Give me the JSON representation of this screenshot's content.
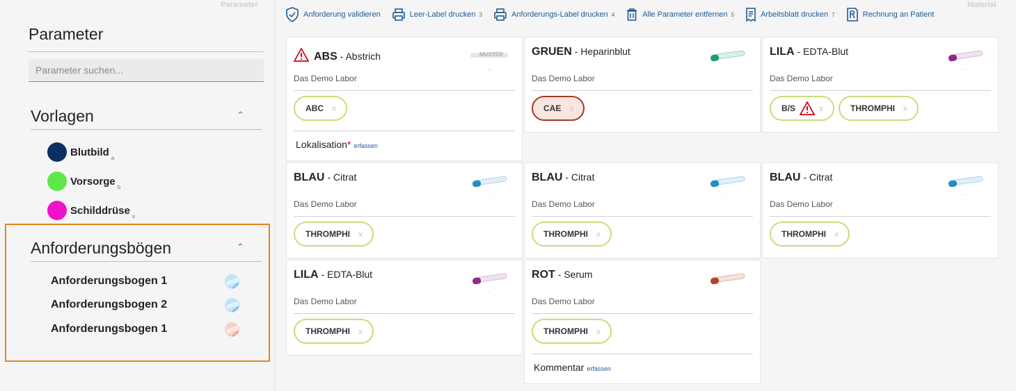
{
  "sidebar": {
    "corner_label": "Parameter",
    "title": "Parameter",
    "search_placeholder": "Parameter suchen...",
    "vorlagen": {
      "title": "Vorlagen",
      "items": [
        {
          "label": "Blutbild",
          "key": "a",
          "color": "#0b2f63"
        },
        {
          "label": "Vorsorge",
          "key": "b",
          "color": "#5ee84a"
        },
        {
          "label": "Schilddrüse",
          "key": "s",
          "color": "#f012c8"
        }
      ]
    },
    "boegen": {
      "title": "Anforderungsbögen",
      "items": [
        {
          "label": "Anforderungsbogen 1",
          "icon": "blue-sheet-icon"
        },
        {
          "label": "Anforderungsbogen 2",
          "icon": "blue-sheet-icon"
        },
        {
          "label": "Anforderungsbogen 1",
          "icon": "salmon-sheet-icon"
        }
      ]
    }
  },
  "toolbar": {
    "corner_label": "Material",
    "actions": [
      {
        "icon": "shield-check-icon",
        "label": "Anforderung validieren",
        "key": ""
      },
      {
        "icon": "printer-icon",
        "label": "Leer-Label drucken",
        "key": "3"
      },
      {
        "icon": "printer-icon",
        "label": "Anforderungs-Label drucken",
        "key": "4"
      },
      {
        "icon": "trash-icon",
        "label": "Alle Parameter entfernen",
        "key": "5"
      },
      {
        "icon": "document-icon",
        "label": "Arbeitsblatt drucken",
        "key": "7"
      },
      {
        "icon": "invoice-icon",
        "label": "Rechnung an Patient",
        "key": ""
      }
    ]
  },
  "cards": [
    {
      "code": "ABS",
      "name": "- Abstrich",
      "lab": "Das Demo Labor",
      "tube": "muster",
      "warning": true,
      "chips": [
        {
          "label": "ABC",
          "x": "x"
        }
      ],
      "footer": {
        "label": "Lokalisation",
        "required": "*",
        "link": "erfassen"
      }
    },
    {
      "code": "GRUEN",
      "name": "- Heparinblut",
      "lab": "Das Demo Labor",
      "tube": "#1f9e6a",
      "chips": [
        {
          "label": "CAE",
          "x": "x",
          "style": "red"
        }
      ]
    },
    {
      "code": "LILA",
      "name": "- EDTA-Blut",
      "lab": "Das Demo Labor",
      "tube": "#8e2a8a",
      "chips": [
        {
          "label": "B/S",
          "x": "x",
          "warning": true
        },
        {
          "label": "THROMPHI",
          "x": "x"
        }
      ]
    },
    {
      "code": "BLAU",
      "name": "- Citrat",
      "lab": "Das Demo Labor",
      "tube": "#1f8fc6",
      "chips": [
        {
          "label": "THROMPHI",
          "x": "x"
        }
      ]
    },
    {
      "code": "BLAU",
      "name": "- Citrat",
      "lab": "Das Demo Labor",
      "tube": "#1f8fc6",
      "chips": [
        {
          "label": "THROMPHI",
          "x": "x"
        }
      ]
    },
    {
      "code": "BLAU",
      "name": "- Citrat",
      "lab": "Das Demo Labor",
      "tube": "#1f8fc6",
      "chips": [
        {
          "label": "THROMPHI",
          "x": "x"
        }
      ]
    },
    {
      "code": "LILA",
      "name": "- EDTA-Blut",
      "lab": "Das Demo Labor",
      "tube": "#8e2a8a",
      "chips": [
        {
          "label": "THROMPHI",
          "x": "x"
        }
      ]
    },
    {
      "code": "ROT",
      "name": "- Serum",
      "lab": "Das Demo Labor",
      "tube": "#b4452a",
      "chips": [
        {
          "label": "THROMPHI",
          "x": "x"
        }
      ],
      "footer": {
        "label": "Kommentar",
        "required": "",
        "link": "erfassen"
      }
    }
  ],
  "colors": {
    "accent": "#1e5a96",
    "highlight": "#e8851f",
    "chip_border": "#c9dc7a",
    "warning": "#d0021b"
  }
}
